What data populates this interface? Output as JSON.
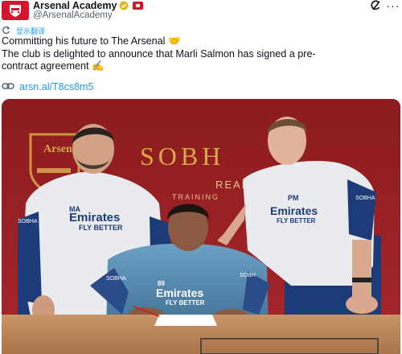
{
  "header": {
    "display_name": "Arsenal Academy",
    "handle": "@ArsenalAcademy",
    "avatar_icon": "arsenal-crest-icon",
    "verified_icon": "verified-gold-badge-icon",
    "affiliate_icon": "arsenal-affiliate-badge-icon",
    "grok_icon": "grok-icon",
    "more_icon": "more-options-icon"
  },
  "translate": {
    "icon": "translate-icon",
    "label": "显示翻译"
  },
  "tweet": {
    "lines": [
      "Committing his future to The Arsenal 🤝",
      "The club is delighted to announce that Marli Salmon has signed a pre-",
      "contract agreement ✍️"
    ]
  },
  "link": {
    "icon": "link-icon",
    "text": "arsn.al/T8cs8m5"
  },
  "photo": {
    "wall_logo_text": "Arsenal",
    "wall_sponsor_text": "SOBH",
    "wall_sub_text_1": "REAL",
    "wall_sub_text_2": "TRAINING",
    "left_man": {
      "initials": "MA",
      "shirt": "Emirates",
      "shirt_sub": "FLY BETTER",
      "sleeve": "SOBHA"
    },
    "right_man": {
      "initials": "PM",
      "shirt": "Emirates",
      "shirt_sub": "FLY BETTER",
      "sleeve": "SOBHA"
    },
    "player": {
      "number": "89",
      "shirt": "Emirates",
      "shirt_sub": "FLY BETTER",
      "sleeve_l": "SOBHA",
      "sleeve_r": "SOBH"
    }
  },
  "colors": {
    "brand_red": "#d3162b",
    "link_blue": "#1d9bf0",
    "muted": "#536471",
    "wall_red": "#9a1f22"
  }
}
